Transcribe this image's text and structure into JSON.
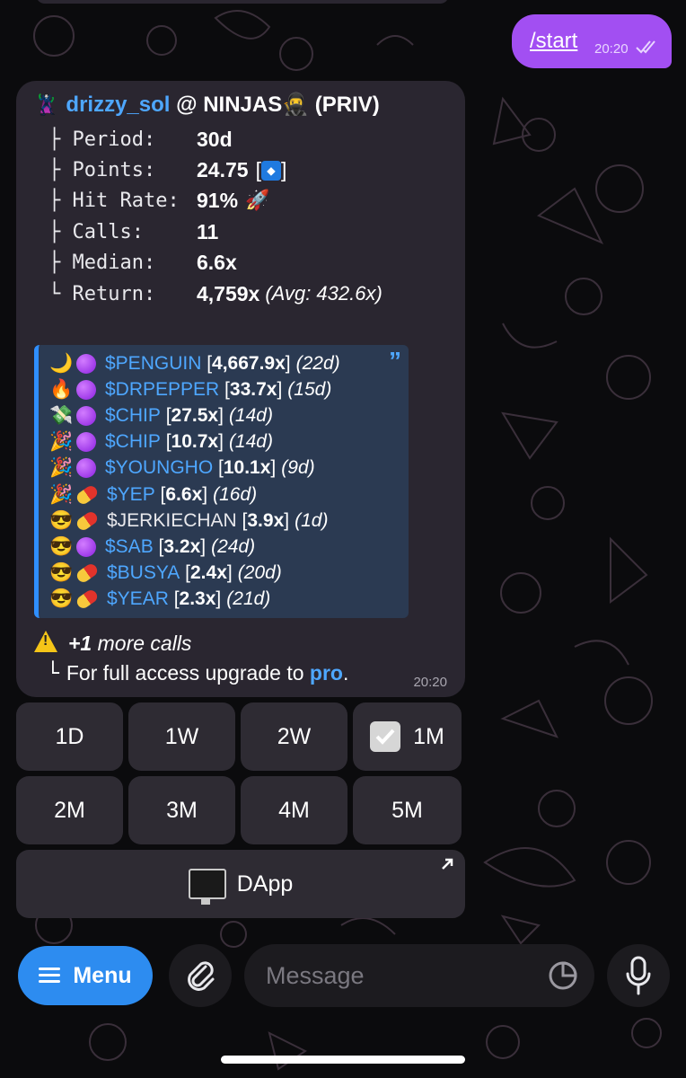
{
  "outgoing": {
    "text": "/start",
    "time": "20:20"
  },
  "card": {
    "emoji": "🦹",
    "username": "drizzy_sol",
    "title_rest": " @ NINJAS🥷 (PRIV)",
    "stats": [
      {
        "label": "├ Period:",
        "value": "30d",
        "extra": ""
      },
      {
        "label": "├ Points:",
        "value": "24.75",
        "extra": ""
      },
      {
        "label": "├ Hit Rate:",
        "value": "91%",
        "extra": ""
      },
      {
        "label": "├ Calls:",
        "value": "11",
        "extra": ""
      },
      {
        "label": "├ Median:",
        "value": "6.6x",
        "extra": ""
      },
      {
        "label": "└ Return:",
        "value": "4,759x",
        "extra": "(Avg: 432.6x)"
      }
    ],
    "points_bracket_open": "[",
    "points_bracket_close": "]",
    "hit_rate_emoji": "🚀",
    "calls": [
      {
        "emoji1": "🌙",
        "emoji2": "purple-circle",
        "ticker": "$PENGUIN",
        "mult": "4,667.9x",
        "age": "(22d)",
        "link": true
      },
      {
        "emoji1": "🔥",
        "emoji2": "purple-circle",
        "ticker": "$DRPEPPER",
        "mult": "33.7x",
        "age": "(15d)",
        "link": true
      },
      {
        "emoji1": "💸",
        "emoji2": "purple-circle",
        "ticker": "$CHIP",
        "mult": "27.5x",
        "age": "(14d)",
        "link": true
      },
      {
        "emoji1": "🎉",
        "emoji2": "purple-circle",
        "ticker": "$CHIP",
        "mult": "10.7x",
        "age": "(14d)",
        "link": true
      },
      {
        "emoji1": "🎉",
        "emoji2": "purple-circle",
        "ticker": "$YOUNGHO",
        "mult": "10.1x",
        "age": "(9d)",
        "link": true
      },
      {
        "emoji1": "🎉",
        "emoji2": "pill",
        "ticker": "$YEP",
        "mult": "6.6x",
        "age": "(16d)",
        "link": true
      },
      {
        "emoji1": "😎",
        "emoji2": "pill",
        "ticker": "$JERKIECHAN",
        "mult": "3.9x",
        "age": "(1d)",
        "link": false
      },
      {
        "emoji1": "😎",
        "emoji2": "purple-circle",
        "ticker": "$SAB",
        "mult": "3.2x",
        "age": "(24d)",
        "link": true
      },
      {
        "emoji1": "😎",
        "emoji2": "pill",
        "ticker": "$BUSYA",
        "mult": "2.4x",
        "age": "(20d)",
        "link": true
      },
      {
        "emoji1": "😎",
        "emoji2": "pill",
        "ticker": "$YEAR",
        "mult": "2.3x",
        "age": "(21d)",
        "link": true
      }
    ],
    "more_count": "+1",
    "more_text": " more calls",
    "upgrade_branch": "└",
    "upgrade_text": "For full access upgrade to ",
    "upgrade_link": "pro",
    "upgrade_end": ".",
    "time": "20:20"
  },
  "keyboard": {
    "row1": [
      "1D",
      "1W",
      "2W",
      "1M"
    ],
    "row2": [
      "2M",
      "3M",
      "4M",
      "5M"
    ],
    "selected": "1M",
    "dapp_label": "DApp"
  },
  "composer": {
    "menu_label": "Menu",
    "message_placeholder": "Message"
  }
}
